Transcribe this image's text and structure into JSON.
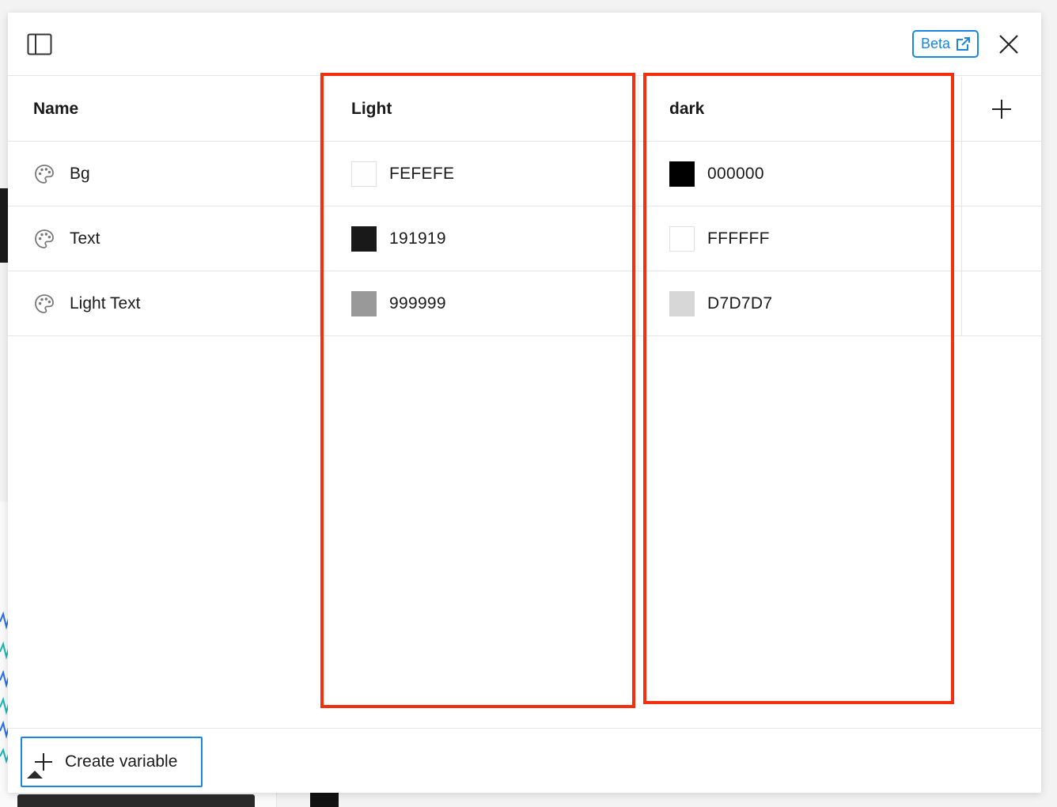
{
  "header": {
    "beta_label": "Beta"
  },
  "columns": {
    "name": "Name",
    "modes": [
      "Light",
      "dark"
    ]
  },
  "variables": [
    {
      "name": "Bg",
      "values": [
        {
          "hex": "FEFEFE",
          "color": "#FEFEFE"
        },
        {
          "hex": "000000",
          "color": "#000000"
        }
      ]
    },
    {
      "name": "Text",
      "values": [
        {
          "hex": "191919",
          "color": "#191919"
        },
        {
          "hex": "FFFFFF",
          "color": "#FFFFFF"
        }
      ]
    },
    {
      "name": "Light Text",
      "values": [
        {
          "hex": "999999",
          "color": "#999999"
        },
        {
          "hex": "D7D7D7",
          "color": "#D7D7D7"
        }
      ]
    }
  ],
  "footer": {
    "create_label": "Create variable"
  },
  "colors": {
    "accent": "#1a86e0",
    "highlight": "#f2300f"
  },
  "icons": [
    "sidebar-toggle-icon",
    "external-link-icon",
    "close-icon",
    "add-mode-icon",
    "palette-icon",
    "plus-icon"
  ]
}
